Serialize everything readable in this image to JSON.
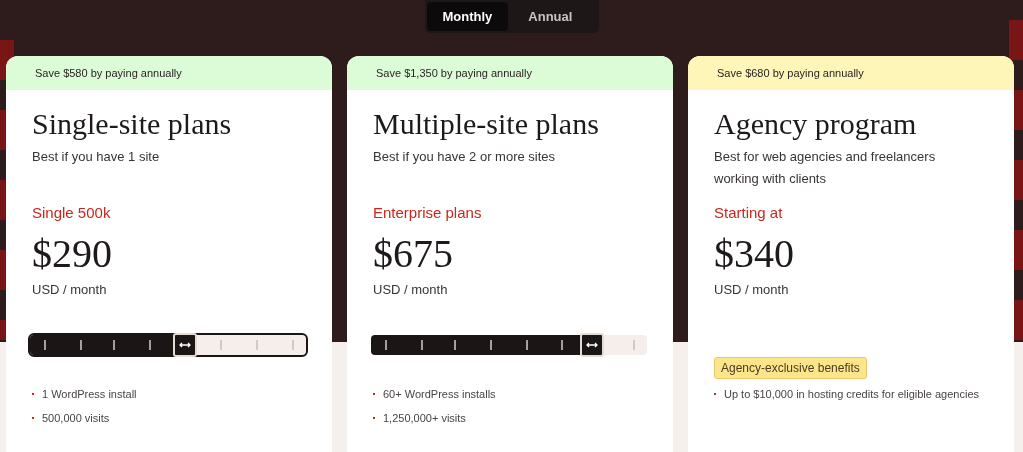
{
  "billing_toggle": [
    {
      "label": "Monthly",
      "selected": true
    },
    {
      "label": "Annual",
      "selected": false
    }
  ],
  "plans": [
    {
      "kind": "slider",
      "banner": "Save $580 by paying annually",
      "color": "#dcfcd8",
      "title": "Single-site plans",
      "subtitle": "Best if you have 1 site",
      "plan_label": "Single 500k",
      "price": "$290",
      "period": "USD / month",
      "focused": true,
      "level": 0.56,
      "features": [
        "1 WordPress install",
        "500,000 visits"
      ]
    },
    {
      "kind": "slider",
      "banner": "Save $1,350 by paying annually",
      "color": "#dcfcd8",
      "title": "Multiple-site plans",
      "subtitle": "Best if you have 2 or more sites",
      "plan_label": "Enterprise plans",
      "price": "$675",
      "period": "USD / month",
      "focused": false,
      "level": 0.8,
      "features": [
        "60+ WordPress installs",
        "1,250,000+ visits"
      ]
    },
    {
      "kind": "badge",
      "banner": "Save $680 by paying annually",
      "color": "#fef6b9",
      "title": "Agency program",
      "subtitle": "Best for web agencies and freelancers working with clients",
      "plan_label": "Starting at",
      "price": "$340",
      "period": "USD / month",
      "badge": "Agency-exclusive benefits",
      "features": [
        "Up to $10,000 in hosting credits for eligible agencies"
      ]
    }
  ]
}
